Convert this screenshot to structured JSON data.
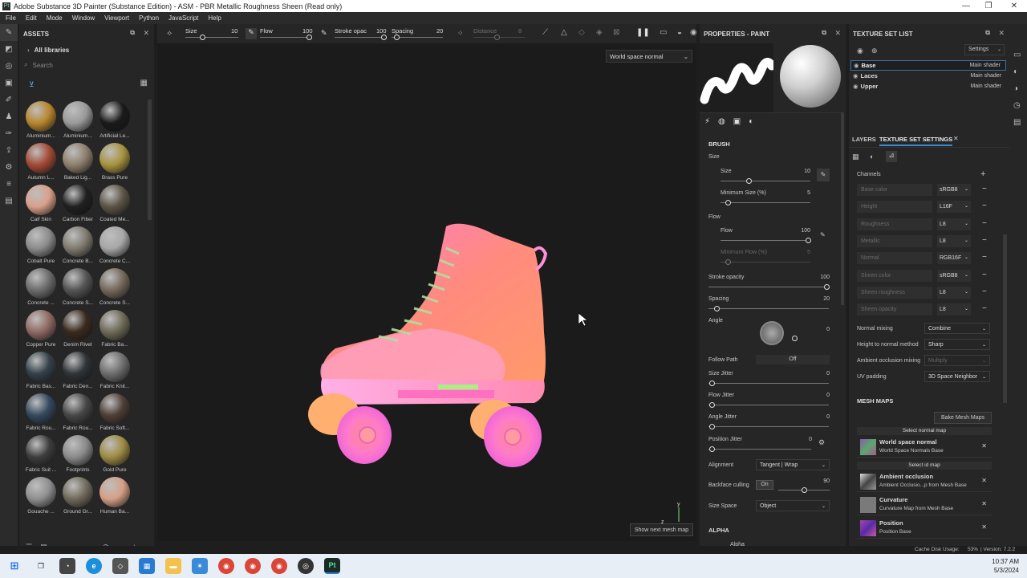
{
  "window": {
    "title": "Adobe Substance 3D Painter (Substance Edition) - ASM - PBR Metallic Roughness Sheen (Read only)",
    "minimize": "—",
    "restore": "❐",
    "close": "✕"
  },
  "menu": [
    "File",
    "Edit",
    "Mode",
    "Window",
    "Viewport",
    "Python",
    "JavaScript",
    "Help"
  ],
  "assets": {
    "title": "ASSETS",
    "library": "All libraries",
    "search_placeholder": "Search",
    "items": [
      {
        "label": "Aluminium...",
        "color": "#b8862e"
      },
      {
        "label": "Aluminium...",
        "color": "#9a9a9a"
      },
      {
        "label": "Artificial Le...",
        "color": "#1a1a1a"
      },
      {
        "label": "Autumn L...",
        "color": "#a34a35"
      },
      {
        "label": "Baked Lig...",
        "color": "#8e7f6c"
      },
      {
        "label": "Brass Pure",
        "color": "#a7933e"
      },
      {
        "label": "Calf Skin",
        "color": "#d9a08a"
      },
      {
        "label": "Carbon Fiber",
        "color": "#202020"
      },
      {
        "label": "Coated Me...",
        "color": "#5c5546"
      },
      {
        "label": "Cobalt Pure",
        "color": "#8b8b8b"
      },
      {
        "label": "Concrete B...",
        "color": "#807a70"
      },
      {
        "label": "Concrete C...",
        "color": "#a7a7a7"
      },
      {
        "label": "Concrete ...",
        "color": "#6c6c6c"
      },
      {
        "label": "Concrete S...",
        "color": "#555555"
      },
      {
        "label": "Concrete S...",
        "color": "#75695b"
      },
      {
        "label": "Copper Pure",
        "color": "#8f6a63"
      },
      {
        "label": "Denim Rivet",
        "color": "#3a2a1e"
      },
      {
        "label": "Fabric Ba...",
        "color": "#6f6a58"
      },
      {
        "label": "Fabric Bas...",
        "color": "#34414a"
      },
      {
        "label": "Fabric Den...",
        "color": "#2f3438"
      },
      {
        "label": "Fabric Knit...",
        "color": "#6e6e6e"
      },
      {
        "label": "Fabric Rou...",
        "color": "#35495e"
      },
      {
        "label": "Fabric Rou...",
        "color": "#474747"
      },
      {
        "label": "Fabric Soft...",
        "color": "#4e3f37"
      },
      {
        "label": "Fabric Suit ...",
        "color": "#3d3d3d"
      },
      {
        "label": "Footprints",
        "color": "#8a8a8a"
      },
      {
        "label": "Gold Pure",
        "color": "#9d8a42"
      },
      {
        "label": "Gouache ...",
        "color": "#8f8f8f"
      },
      {
        "label": "Ground Gr...",
        "color": "#716a5b"
      },
      {
        "label": "Human Ba...",
        "color": "#d59f86"
      }
    ]
  },
  "toolbar": {
    "size_label": "Size",
    "size_value": "10",
    "flow_label": "Flow",
    "flow_value": "100",
    "stroke_label": "Stroke opac",
    "stroke_value": "100",
    "spacing_label": "Spacing",
    "spacing_value": "20",
    "distance_label": "Distance",
    "distance_value": "8"
  },
  "viewport": {
    "mode": "World space normal",
    "next_mesh": "Show next mesh map",
    "axis_y": "y",
    "axis_z": "z"
  },
  "properties": {
    "title": "PROPERTIES - PAINT",
    "brush": "BRUSH",
    "size_group": "Size",
    "size": "Size",
    "size_val": "10",
    "min_size": "Minimum Size (%)",
    "min_size_val": "5",
    "flow_group": "Flow",
    "flow": "Flow",
    "flow_val": "100",
    "min_flow": "Minimum Flow (%)",
    "min_flow_val": "5",
    "stroke_opacity": "Stroke opacity",
    "stroke_opacity_val": "100",
    "spacing": "Spacing",
    "spacing_val": "20",
    "angle": "Angle",
    "angle_val": "0",
    "follow_path": "Follow Path",
    "follow_path_val": "Off",
    "size_jitter": "Size Jitter",
    "size_jitter_val": "0",
    "flow_jitter": "Flow Jitter",
    "flow_jitter_val": "0",
    "angle_jitter": "Angle Jitter",
    "angle_jitter_val": "0",
    "position_jitter": "Position Jitter",
    "position_jitter_val": "0",
    "alignment": "Alignment",
    "alignment_val": "Tangent | Wrap",
    "backface": "Backface culling",
    "backface_toggle": "On",
    "backface_val": "90",
    "size_space": "Size Space",
    "size_space_val": "Object",
    "alpha": "ALPHA",
    "alpha_item": "Alpha"
  },
  "texture_set_list": {
    "title": "TEXTURE SET LIST",
    "settings": "Settings",
    "sets": [
      {
        "name": "Base",
        "shader": "Main shader"
      },
      {
        "name": "Laces",
        "shader": "Main shader"
      },
      {
        "name": "Upper",
        "shader": "Main shader"
      }
    ]
  },
  "tss": {
    "tab_layers": "LAYERS",
    "tab_tss": "TEXTURE SET SETTINGS",
    "channels_label": "Channels",
    "channels": [
      {
        "name": "Base color",
        "fmt": "sRGB8"
      },
      {
        "name": "Height",
        "fmt": "L16F"
      },
      {
        "name": "Roughness",
        "fmt": "L8"
      },
      {
        "name": "Metallic",
        "fmt": "L8"
      },
      {
        "name": "Normal",
        "fmt": "RGB16F"
      },
      {
        "name": "Sheen color",
        "fmt": "sRGB8"
      },
      {
        "name": "Sheen roughness",
        "fmt": "L8"
      },
      {
        "name": "Sheen opacity",
        "fmt": "L8"
      }
    ],
    "normal_mixing": "Normal mixing",
    "normal_mixing_val": "Combine",
    "h2n": "Height to normal method",
    "h2n_val": "Sharp",
    "ao_mixing": "Ambient occlusion mixing",
    "ao_mixing_val": "Multiply",
    "uv_padding": "UV padding",
    "uv_padding_val": "3D Space Neighbor",
    "mesh_maps": "MESH MAPS",
    "bake": "Bake Mesh Maps",
    "select_normal": "Select normal map",
    "select_id": "Select id map",
    "maps": [
      {
        "title": "World space normal",
        "sub": "World Space Normals Base",
        "color": "#8c5aa8"
      },
      {
        "title": "Ambient occlusion",
        "sub": "Ambient Occlusio...p from Mesh Base",
        "color": "#6e6e6e"
      },
      {
        "title": "Curvature",
        "sub": "Curvature Map from Mesh Base",
        "color": "#7a7a7a"
      },
      {
        "title": "Position",
        "sub": "Position Base",
        "color": "#a04aa8"
      }
    ]
  },
  "status": {
    "cache": "Cache Disk Usage:",
    "cache_val": "53%",
    "version": "| Version: 7.2.2"
  },
  "taskbar": {
    "time": "10:37 AM",
    "date": "5/3/2024"
  }
}
